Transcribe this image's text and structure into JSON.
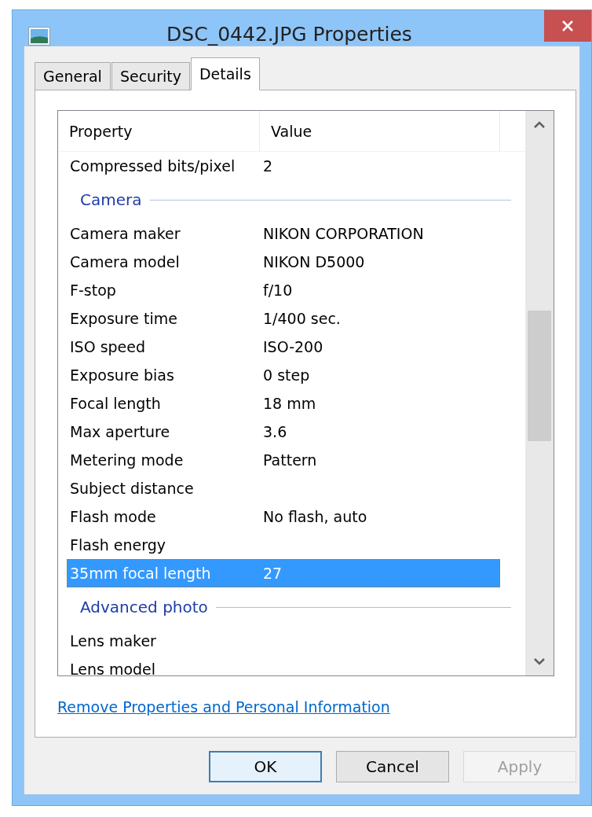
{
  "window": {
    "title": "DSC_0442.JPG Properties"
  },
  "tabs": [
    {
      "label": "General",
      "selected": false
    },
    {
      "label": "Security",
      "selected": false
    },
    {
      "label": "Details",
      "selected": true
    }
  ],
  "list": {
    "columns": [
      "Property",
      "Value"
    ],
    "rows": [
      {
        "kind": "item",
        "property": "Compressed bits/pixel",
        "value": "2",
        "selected": false
      },
      {
        "kind": "group",
        "label": "Camera"
      },
      {
        "kind": "item",
        "property": "Camera maker",
        "value": "NIKON CORPORATION",
        "selected": false
      },
      {
        "kind": "item",
        "property": "Camera model",
        "value": "NIKON D5000",
        "selected": false
      },
      {
        "kind": "item",
        "property": "F-stop",
        "value": "f/10",
        "selected": false
      },
      {
        "kind": "item",
        "property": "Exposure time",
        "value": "1/400 sec.",
        "selected": false
      },
      {
        "kind": "item",
        "property": "ISO speed",
        "value": "ISO-200",
        "selected": false
      },
      {
        "kind": "item",
        "property": "Exposure bias",
        "value": "0 step",
        "selected": false
      },
      {
        "kind": "item",
        "property": "Focal length",
        "value": "18 mm",
        "selected": false
      },
      {
        "kind": "item",
        "property": "Max aperture",
        "value": "3.6",
        "selected": false
      },
      {
        "kind": "item",
        "property": "Metering mode",
        "value": "Pattern",
        "selected": false
      },
      {
        "kind": "item",
        "property": "Subject distance",
        "selected": false
      },
      {
        "kind": "item",
        "property": "Flash mode",
        "value": "No flash, auto",
        "selected": false
      },
      {
        "kind": "item",
        "property": "Flash energy",
        "selected": false
      },
      {
        "kind": "item",
        "property": "35mm focal length",
        "value": "27",
        "selected": true
      },
      {
        "kind": "group",
        "label": "Advanced photo"
      },
      {
        "kind": "item",
        "property": "Lens maker",
        "selected": false
      },
      {
        "kind": "item",
        "property": "Lens model",
        "selected": false
      }
    ]
  },
  "link": "Remove Properties and Personal Information",
  "buttons": [
    {
      "label": "OK",
      "default": true,
      "disabled": false
    },
    {
      "label": "Cancel",
      "default": false,
      "disabled": false
    },
    {
      "label": "Apply",
      "default": false,
      "disabled": true
    }
  ]
}
